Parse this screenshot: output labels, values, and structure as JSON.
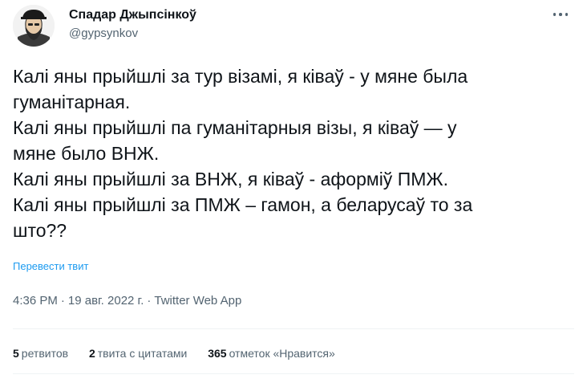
{
  "tweet": {
    "author": {
      "display_name": "Спадар Джыпсінкоў",
      "handle": "@gypsynkov",
      "avatar_icon": "avatar-illustration"
    },
    "body_lines": [
      "Калі яны прыйшлі за тур візамі, я ківаў - у мяне была",
      "гуманітарная.",
      "Калі яны прыйшлі па гуманітарныя візы, я ківаў — у",
      "мяне было ВНЖ.",
      "Калі яны прыйшлі за ВНЖ, я ківаў - аформіў ПМЖ.",
      "Калі яны прыйшлі за ПМЖ – гамон, а беларусаў то за",
      "што??"
    ],
    "translate_label": "Перевести твит",
    "timestamp": {
      "time": "4:36 PM",
      "separator": "·",
      "date": "19 авг. 2022 г.",
      "source": "Twitter Web App"
    },
    "stats": {
      "retweets": {
        "count": "5",
        "label": "ретвитов"
      },
      "quotes": {
        "count": "2",
        "label": "твита с цитатами"
      },
      "likes": {
        "count": "365",
        "label": "отметок «Нравится»"
      }
    },
    "more_icon": "more-dots-icon",
    "colors": {
      "text_primary": "#0f1419",
      "text_secondary": "#536471",
      "link": "#1d9bf0",
      "divider": "#eff3f4"
    }
  }
}
